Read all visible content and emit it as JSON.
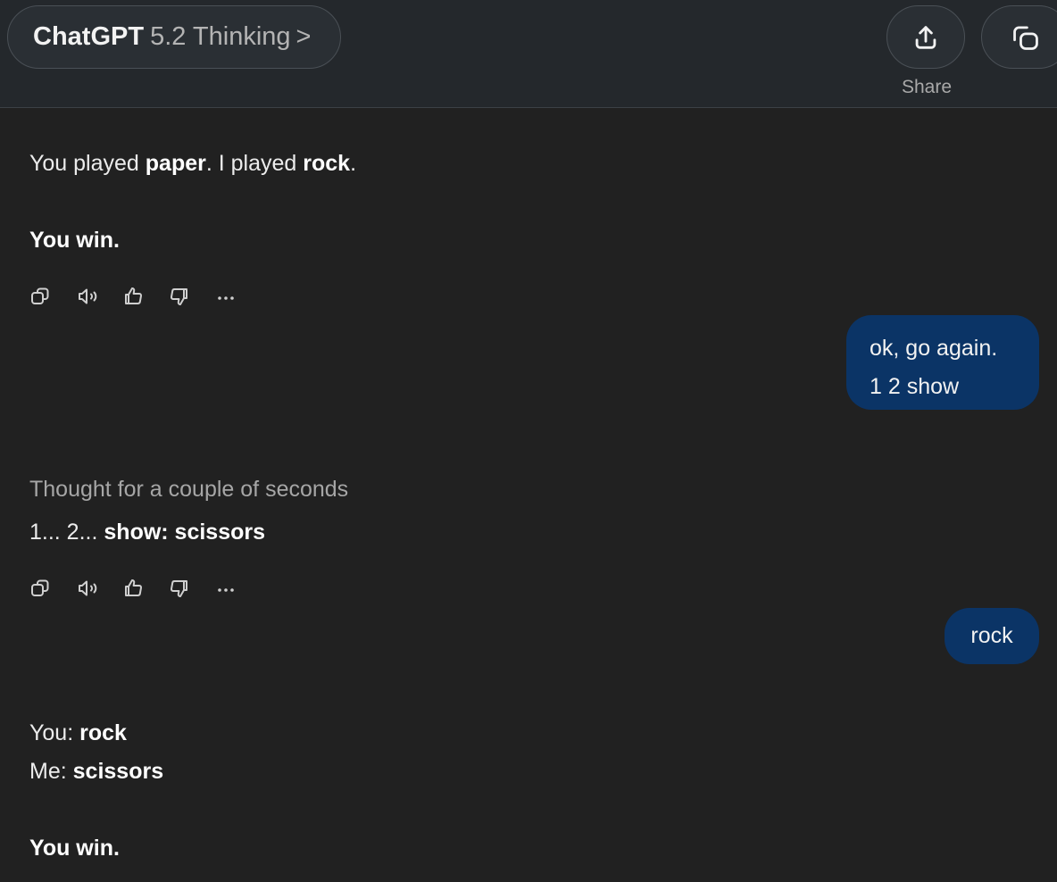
{
  "header": {
    "model_name": "ChatGPT",
    "model_version": "5.2 Thinking",
    "chevron": ">",
    "share_label": "Share",
    "share_icon": "share-upload-icon",
    "copy_icon": "new-chat-copy-icon"
  },
  "messages": {
    "m1": {
      "p1": "You played",
      "w1": "paper",
      "p2": ". I played",
      "w2": "rock",
      "p3": ".",
      "result": "You win."
    },
    "u1": {
      "line1": "ok, go again.",
      "line2": "1 2 show"
    },
    "m2": {
      "thought": "Thought for a couple of seconds",
      "p1": "1... 2...",
      "w1": "show: scissors"
    },
    "u2": {
      "text": "rock"
    },
    "m3": {
      "l1_label": "You:",
      "l1_value": "rock",
      "l2_label": "Me:",
      "l2_value": "scissors",
      "result": "You win."
    }
  },
  "action_icons": [
    "copy-icon",
    "read-aloud-icon",
    "thumbs-up-icon",
    "thumbs-down-icon",
    "more-icon"
  ],
  "colors": {
    "background": "#212121",
    "header": "#24282c",
    "user_bubble": "#0b3466"
  }
}
